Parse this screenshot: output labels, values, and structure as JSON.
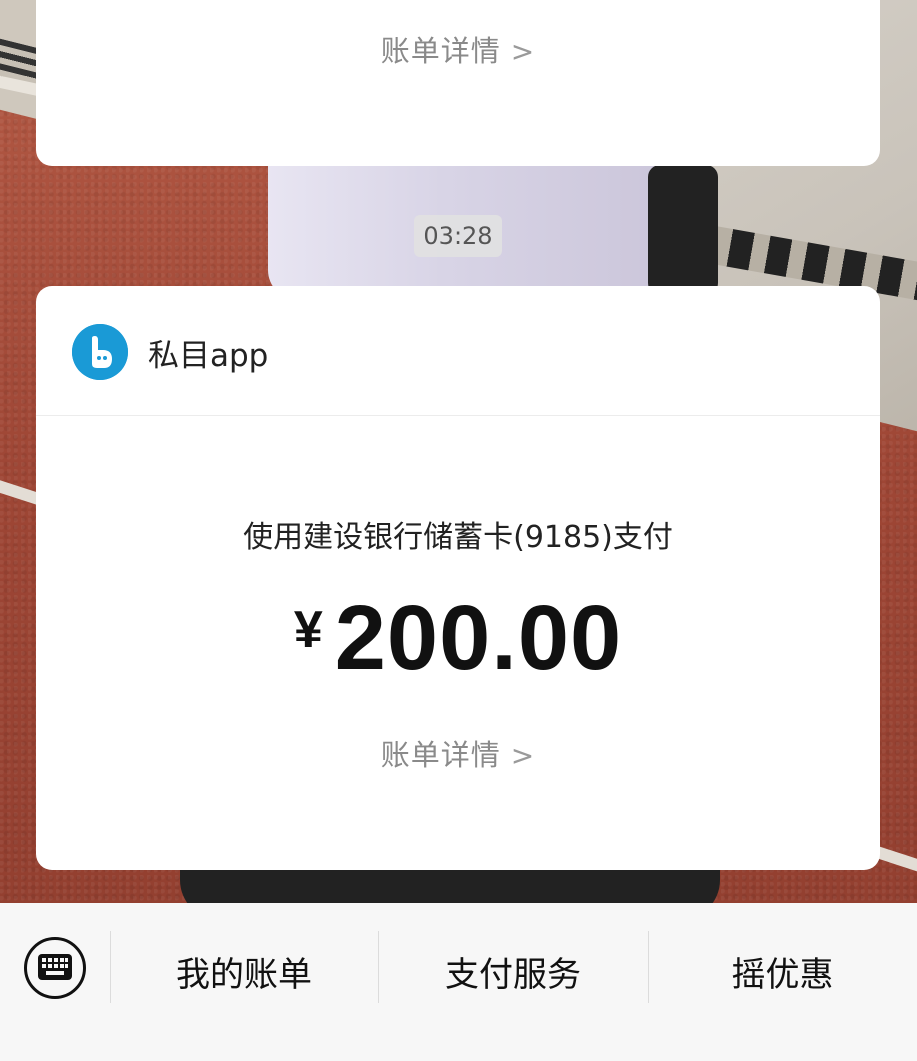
{
  "top_card": {
    "detail_label": "账单详情",
    "chevron_icon": "chevron-right-icon"
  },
  "timestamp": "03:28",
  "payment_card": {
    "app_name": "私目app",
    "app_icon": "app-logo-icon",
    "pay_method": "使用建设银行储蓄卡(9185)支付",
    "currency_symbol": "¥",
    "amount": "200.00",
    "detail_label": "账单详情",
    "chevron_icon": "chevron-right-icon"
  },
  "bottom_menu": {
    "keyboard_icon": "keyboard-icon",
    "items": [
      {
        "label": "我的账单"
      },
      {
        "label": "支付服务"
      },
      {
        "label": "摇优惠"
      }
    ]
  },
  "colors": {
    "app_logo": "#1a9ad6",
    "card_bg": "#ffffff",
    "link_text": "#8a8a8a",
    "menu_bg": "#f7f7f7"
  }
}
